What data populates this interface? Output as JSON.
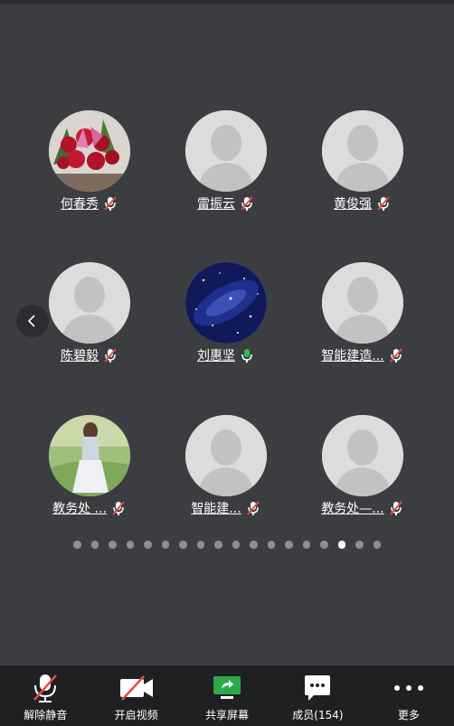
{
  "participants": [
    {
      "name": "何春秀",
      "mic": "muted",
      "avatar": "flowers-photo"
    },
    {
      "name": "雷振云",
      "mic": "muted",
      "avatar": "default-person"
    },
    {
      "name": "黄俊强",
      "mic": "muted",
      "avatar": "default-person"
    },
    {
      "name": "陈碧毅",
      "mic": "muted",
      "avatar": "default-person"
    },
    {
      "name": "刘惠坚",
      "mic": "active",
      "avatar": "galaxy-photo"
    },
    {
      "name": "智能建造...",
      "mic": "muted",
      "avatar": "default-person"
    },
    {
      "name": "教务处 ...",
      "mic": "muted",
      "avatar": "girl-photo"
    },
    {
      "name": "智能建...",
      "mic": "muted",
      "avatar": "default-person"
    },
    {
      "name": "教务处—...",
      "mic": "muted",
      "avatar": "default-person"
    }
  ],
  "pagination": {
    "total": 18,
    "current": 16
  },
  "toolbar": {
    "unmute": "解除静音",
    "video": "开启视频",
    "share": "共享屏幕",
    "members": "成员(154)",
    "more": "更多"
  },
  "colors": {
    "background": "#3b3d40",
    "toolbar": "#1f2022",
    "muted": "#e04a4a",
    "active_mic": "#2dbf4e",
    "share": "#2ea84a"
  }
}
